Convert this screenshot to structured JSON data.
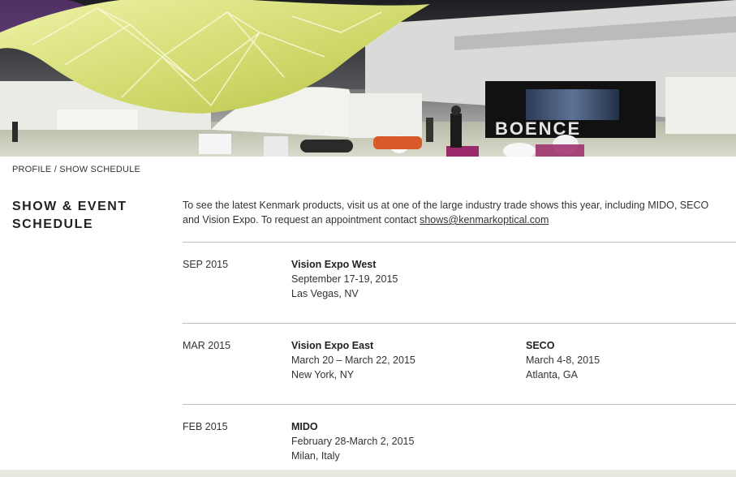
{
  "breadcrumb": {
    "profile": "PROFILE",
    "separator": "/",
    "current": "SHOW SCHEDULE"
  },
  "page_title": "SHOW & EVENT SCHEDULE",
  "intro": {
    "text": "To see the latest Kenmark products, visit us at one of the large industry trade shows this year, including MIDO, SECO and Vision Expo. To request an appointment contact",
    "email": "shows@kenmarkoptical.com"
  },
  "hero": {
    "booth_sign": "BOENCE"
  },
  "schedule": [
    {
      "date": "SEP 2015",
      "events": [
        {
          "name": "Vision Expo West",
          "dates": "September 17-19, 2015",
          "location": "Las Vegas, NV"
        }
      ]
    },
    {
      "date": "MAR 2015",
      "events": [
        {
          "name": "Vision Expo East",
          "dates": "March 20 – March 22, 2015",
          "location": "New York, NY"
        },
        {
          "name": "SECO",
          "dates": "March 4-8, 2015",
          "location": "Atlanta, GA"
        }
      ]
    },
    {
      "date": "FEB 2015",
      "events": [
        {
          "name": "MIDO",
          "dates": "February 28-March 2, 2015",
          "location": "Milan, Italy"
        }
      ]
    }
  ],
  "colors": {
    "text": "#333333",
    "rule": "#bdbdbd",
    "canopy": "#d8e07a",
    "footer_band": "#e8e8df"
  }
}
